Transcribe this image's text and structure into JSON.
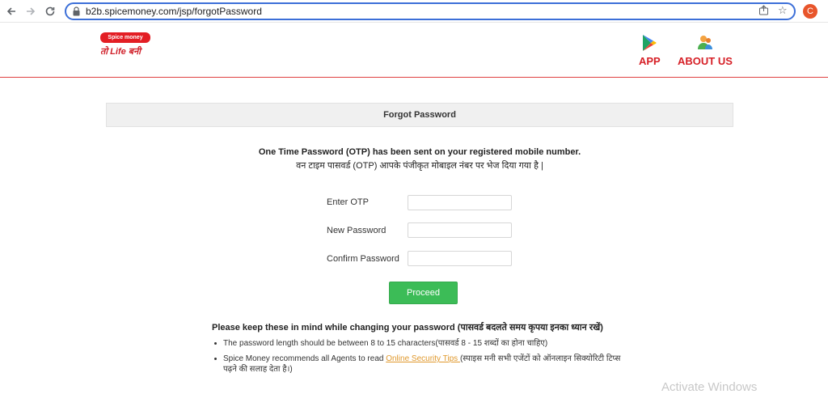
{
  "browser": {
    "url": "b2b.spicemoney.com/jsp/forgotPassword",
    "avatar_letter": "C",
    "accent": "#3c6fd8"
  },
  "header": {
    "logo_badge": "Spice money",
    "logo_tagline": "तो Life बनी",
    "nav": [
      {
        "label": "APP",
        "icon": "play-store-icon"
      },
      {
        "label": "ABOUT US",
        "icon": "people-icon"
      }
    ],
    "brand_color": "#d62027"
  },
  "form": {
    "title": "Forgot Password",
    "otp_message_en": "One Time Password (OTP) has been sent on your registered mobile number.",
    "otp_message_hi": "वन टाइम पासवर्ड (OTP) आपके पंजीकृत मोबाइल नंबर पर भेज दिया गया है |",
    "fields": [
      {
        "label": "Enter OTP",
        "value": ""
      },
      {
        "label": "New Password",
        "value": ""
      },
      {
        "label": "Confirm Password",
        "value": ""
      }
    ],
    "proceed_label": "Proceed",
    "button_color": "#3cbc57"
  },
  "notes": {
    "heading": "Please keep these in mind while changing your password (पासवर्ड बदलते समय कृपया इनका ध्यान रखें)",
    "item1": "The password length should be between 8 to 15 characters(पासवर्ड 8 - 15 शब्दों का होना चाहिए)",
    "item2_prefix": "Spice Money recommends all Agents to read ",
    "item2_link": "Online Security Tips ",
    "item2_suffix": "(स्पाइस मनी सभी एजेंटों को ऑनलाइन सिक्योरिटी टिप्स पढ़ने की सलाह देता है।)"
  },
  "watermark": "Activate Windows"
}
